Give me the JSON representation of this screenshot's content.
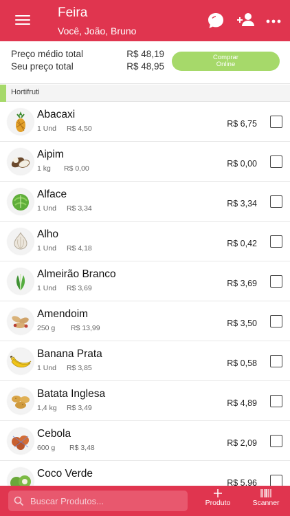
{
  "header": {
    "title": "Feira",
    "subtitle": "Você, João, Bruno",
    "icons": [
      "menu-icon",
      "chat-icon",
      "add-user-icon",
      "more-icon"
    ]
  },
  "summary": {
    "avg_label": "Preço médio total",
    "avg_value": "R$ 48,19",
    "your_label": "Seu preço total",
    "your_value": "R$ 48,95",
    "buy_button_line1": "Comprar",
    "buy_button_line2": "Online"
  },
  "category": {
    "label": "Hortifruti"
  },
  "items": [
    {
      "name": "Abacaxi",
      "qty": "1 Und",
      "unit_price": "R$ 4,50",
      "price": "R$ 6,75",
      "icon": "pineapple-icon"
    },
    {
      "name": "Aipim",
      "qty": "1 kg",
      "unit_price": "R$ 0,00",
      "price": "R$ 0,00",
      "icon": "cassava-icon"
    },
    {
      "name": "Alface",
      "qty": "1 Und",
      "unit_price": "R$ 3,34",
      "price": "R$ 3,34",
      "icon": "lettuce-icon"
    },
    {
      "name": "Alho",
      "qty": "1 Und",
      "unit_price": "R$ 4,18",
      "price": "R$ 0,42",
      "icon": "garlic-icon"
    },
    {
      "name": "Almeirão Branco",
      "qty": "1 Und",
      "unit_price": "R$ 3,69",
      "price": "R$ 3,69",
      "icon": "chicory-icon"
    },
    {
      "name": "Amendoim",
      "qty": "250 g",
      "unit_price": "R$ 13,99",
      "price": "R$ 3,50",
      "icon": "peanut-icon"
    },
    {
      "name": "Banana Prata",
      "qty": "1 Und",
      "unit_price": "R$ 3,85",
      "price": "R$ 0,58",
      "icon": "banana-icon"
    },
    {
      "name": "Batata Inglesa",
      "qty": "1,4 kg",
      "unit_price": "R$ 3,49",
      "price": "R$ 4,89",
      "icon": "potato-icon"
    },
    {
      "name": "Cebola",
      "qty": "600 g",
      "unit_price": "R$ 3,48",
      "price": "R$ 2,09",
      "icon": "onion-icon"
    },
    {
      "name": "Coco Verde",
      "qty": "",
      "unit_price": "",
      "price": "R$ 5,96",
      "icon": "coconut-icon"
    }
  ],
  "bottom": {
    "search_placeholder": "Buscar Produtos...",
    "produto_label": "Produto",
    "scanner_label": "Scanner"
  },
  "colors": {
    "brand": "#e0354f",
    "accent": "#a6d96a"
  }
}
